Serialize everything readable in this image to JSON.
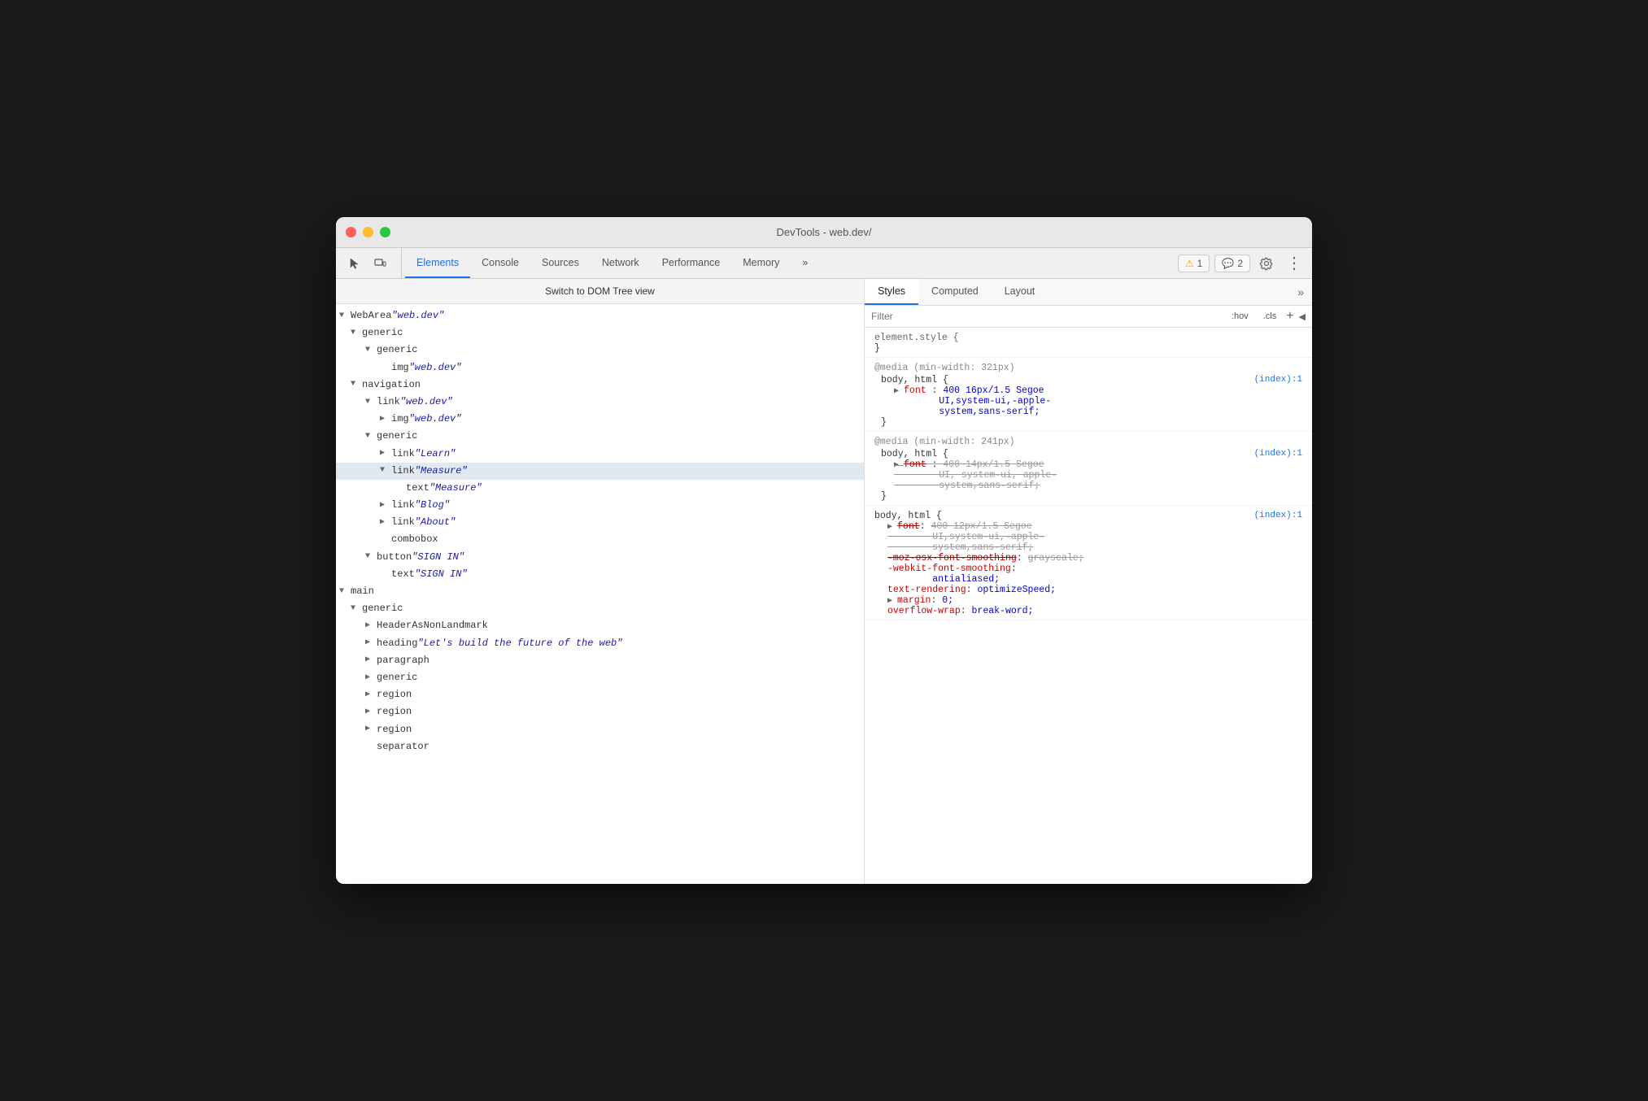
{
  "window": {
    "title": "DevTools - web.dev/"
  },
  "toolbar": {
    "cursor_icon": "⬆",
    "frame_icon": "⬚",
    "tabs": [
      {
        "id": "elements",
        "label": "Elements",
        "active": true
      },
      {
        "id": "console",
        "label": "Console",
        "active": false
      },
      {
        "id": "sources",
        "label": "Sources",
        "active": false
      },
      {
        "id": "network",
        "label": "Network",
        "active": false
      },
      {
        "id": "performance",
        "label": "Performance",
        "active": false
      },
      {
        "id": "memory",
        "label": "Memory",
        "active": false
      }
    ],
    "more_tabs": "»",
    "warn_count": "1",
    "info_count": "2",
    "gear_icon": "⚙",
    "more_icon": "⋮"
  },
  "dom_panel": {
    "switch_bar_label": "Switch to DOM Tree view",
    "tree": [
      {
        "id": "webarea",
        "indent": 0,
        "arrow": "expanded",
        "text": "WebArea ",
        "italic": "\"web.dev\""
      },
      {
        "id": "generic1",
        "indent": 1,
        "arrow": "expanded",
        "text": "generic"
      },
      {
        "id": "generic2",
        "indent": 2,
        "arrow": "expanded",
        "text": "generic"
      },
      {
        "id": "img1",
        "indent": 3,
        "arrow": "leaf",
        "text": "img ",
        "italic": "\"web.dev\""
      },
      {
        "id": "navigation",
        "indent": 1,
        "arrow": "expanded",
        "text": "navigation"
      },
      {
        "id": "link-webdev",
        "indent": 2,
        "arrow": "expanded",
        "text": "link ",
        "italic": "\"web.dev\""
      },
      {
        "id": "img-webdev",
        "indent": 3,
        "arrow": "collapsed",
        "text": "img ",
        "italic": "\"web.dev\""
      },
      {
        "id": "generic3",
        "indent": 2,
        "arrow": "expanded",
        "text": "generic"
      },
      {
        "id": "link-learn",
        "indent": 3,
        "arrow": "collapsed",
        "text": "link ",
        "italic": "\"Learn\""
      },
      {
        "id": "link-measure",
        "indent": 3,
        "arrow": "expanded",
        "text": "link ",
        "italic": "\"Measure\"",
        "selected": true
      },
      {
        "id": "text-measure",
        "indent": 4,
        "arrow": "leaf",
        "text": "text ",
        "italic": "\"Measure\""
      },
      {
        "id": "link-blog",
        "indent": 3,
        "arrow": "collapsed",
        "text": "link ",
        "italic": "\"Blog\""
      },
      {
        "id": "link-about",
        "indent": 3,
        "arrow": "collapsed",
        "text": "link ",
        "italic": "\"About\""
      },
      {
        "id": "combobox",
        "indent": 3,
        "arrow": "leaf",
        "text": "combobox"
      },
      {
        "id": "button-signin",
        "indent": 2,
        "arrow": "expanded",
        "text": "button ",
        "italic": "\"SIGN IN\""
      },
      {
        "id": "text-signin",
        "indent": 3,
        "arrow": "leaf",
        "text": "text ",
        "italic": "\"SIGN IN\""
      },
      {
        "id": "main",
        "indent": 0,
        "arrow": "expanded",
        "text": "main"
      },
      {
        "id": "generic4",
        "indent": 1,
        "arrow": "expanded",
        "text": "generic"
      },
      {
        "id": "header-nonlandmark",
        "indent": 2,
        "arrow": "collapsed",
        "text": "HeaderAsNonLandmark"
      },
      {
        "id": "heading",
        "indent": 2,
        "arrow": "collapsed",
        "text": "heading ",
        "italic": "\"Let's build the future of the web\""
      },
      {
        "id": "paragraph",
        "indent": 2,
        "arrow": "collapsed",
        "text": "paragraph"
      },
      {
        "id": "generic5",
        "indent": 2,
        "arrow": "collapsed",
        "text": "generic"
      },
      {
        "id": "region1",
        "indent": 2,
        "arrow": "collapsed",
        "text": "region"
      },
      {
        "id": "region2",
        "indent": 2,
        "arrow": "collapsed",
        "text": "region"
      },
      {
        "id": "region3",
        "indent": 2,
        "arrow": "collapsed",
        "text": "region"
      },
      {
        "id": "separator",
        "indent": 2,
        "arrow": "leaf",
        "text": "separator"
      }
    ]
  },
  "styles_panel": {
    "tabs": [
      {
        "id": "styles",
        "label": "Styles",
        "active": true
      },
      {
        "id": "computed",
        "label": "Computed",
        "active": false
      },
      {
        "id": "layout",
        "label": "Layout",
        "active": false
      }
    ],
    "more": "»",
    "filter_placeholder": "Filter",
    "hov_btn": ":hov",
    "cls_btn": ".cls",
    "rules": [
      {
        "id": "element-style",
        "selector": "element.style {",
        "close": "}",
        "source": "",
        "props": []
      },
      {
        "id": "media-321",
        "media": "@media (min-width: 321px)",
        "selector": "body, html {",
        "source": "(index):1",
        "close": "}",
        "props": [
          {
            "name": "font",
            "triangle": true,
            "value": " 400 16px/1.5 Segoe UI,system-ui,-apple-system,sans-serif;",
            "strikethrough": false
          }
        ]
      },
      {
        "id": "media-241",
        "media": "@media (min-width: 241px)",
        "selector": "body, html {",
        "source": "(index):1",
        "close": "}",
        "props": [
          {
            "name": "font",
            "triangle": true,
            "value": " 400 14px/1.5 Segoe UI, system-ui, apple-system,sans-serif;",
            "strikethrough": true
          }
        ]
      },
      {
        "id": "body-html",
        "selector": "body, html {",
        "source": "(index):1",
        "close": "}",
        "props": [
          {
            "name": "font",
            "triangle": true,
            "value": " 400 12px/1.5 Segoe UI,system-ui,-apple-system,sans-serif;",
            "strikethrough": true
          },
          {
            "name": "-moz-osx-font-smoothing",
            "value": " grayscale;",
            "strikethrough": true
          },
          {
            "name": "-webkit-font-smoothing",
            "value": " antialiased;",
            "strikethrough": false,
            "red_name": true
          },
          {
            "name": "text-rendering",
            "value": " optimizeSpeed;",
            "strikethrough": false,
            "red_name": true
          },
          {
            "name": "margin",
            "triangle": true,
            "value": " 0;",
            "strikethrough": false,
            "red_name": true
          },
          {
            "name": "overflow-wrap",
            "value": " break-word;",
            "strikethrough": false,
            "red_name": true,
            "partial": true
          }
        ]
      }
    ]
  }
}
